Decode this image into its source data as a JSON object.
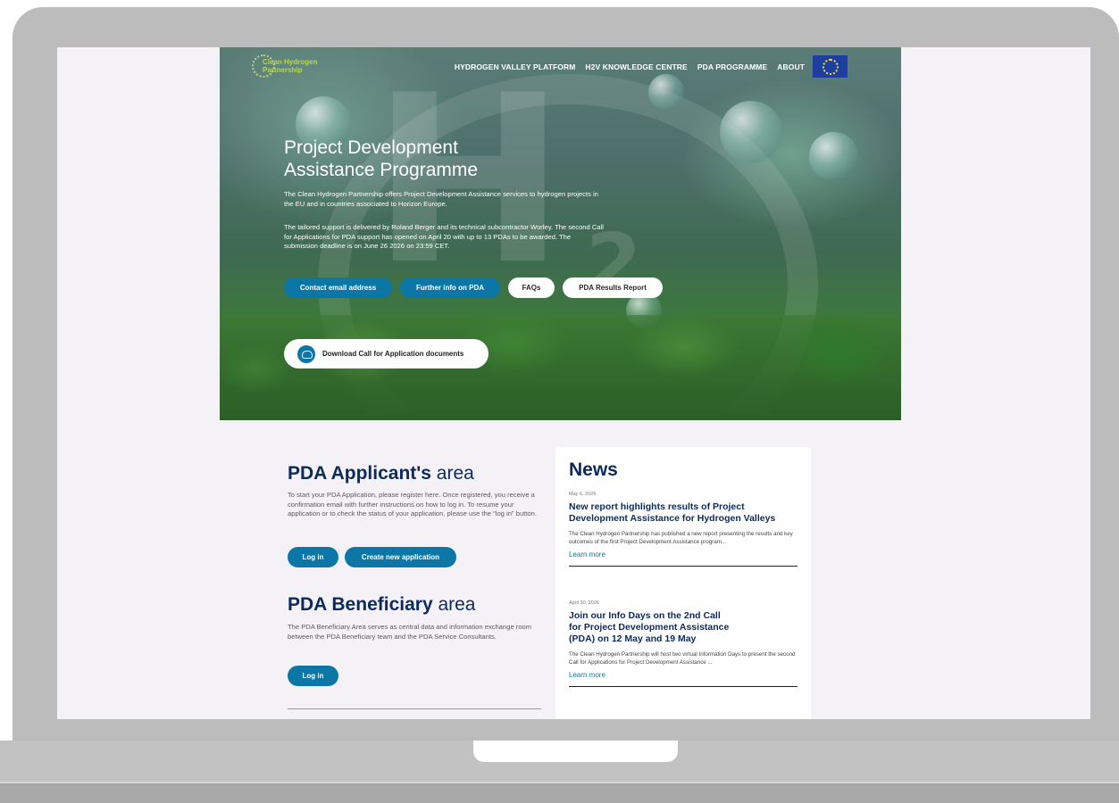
{
  "nav": {
    "logo_line1": "Clean Hydrogen",
    "logo_line2": "Partnership",
    "links": [
      "HYDROGEN VALLEY PLATFORM",
      "H2V KNOWLEDGE CENTRE",
      "PDA PROGRAMME",
      "ABOUT"
    ]
  },
  "hero": {
    "title_line1": "Project Development",
    "title_line2": "Assistance Programme",
    "paragraph1": "The Clean Hydrogen Partnership offers Project Development Assistance services to hydrogen projects in the EU and in countries associated to Horizon Europe.",
    "paragraph2": "The tailored support is delivered by Roland Berger and its technical subcontractor Worley. The second Call for Applications for PDA support has opened on April 20 with up to 13 PDAs to be awarded. The submission deadline is on June 26 2026 on 23:59 CET.",
    "buttons": [
      "Contact email address",
      "Further info on PDA",
      "FAQs",
      "PDA Results Report"
    ],
    "download_label": "Download Call for Application documents"
  },
  "applicant": {
    "title_bold": "PDA Applicant's",
    "title_light": " area",
    "text": "To start your PDA Application, please register here. Once registered, you receive a confirmation email with further instructions on how to log in. To resume your application or to check the status of your application, please use the \"log in\" button.",
    "login_label": "Log in",
    "create_label": "Create new application"
  },
  "beneficiary": {
    "title_bold": "PDA Beneficiary",
    "title_light": " area",
    "text": "The PDA Beneficiary Area serves as central data and information exchange room between the PDA Beneficiary team and the PDA Service Consultants.",
    "login_label": "Log in"
  },
  "news": {
    "title": "News",
    "items": [
      {
        "date": "May 6, 2026",
        "headline_l1": "New report highlights results of Project",
        "headline_l2": "Development Assistance for Hydrogen Valleys",
        "headline_l3": "",
        "body": "The Clean Hydrogen Partnership has published a new report presenting the results and key outcomes of the first Project Development Assistance program...",
        "link": "Learn more"
      },
      {
        "date": "April 30, 2026",
        "headline_l1": "Join our Info Days on the 2nd Call",
        "headline_l2": "for Project Development Assistance",
        "headline_l3": "(PDA) on 12 May and 19 May",
        "body": "The Clean Hydrogen Partnership will host two virtual Information Days to present the second Call for Applications for Project Development Assistance ...",
        "link": "Learn more"
      }
    ]
  },
  "colors": {
    "accent": "#0c77a6",
    "heading": "#0d2a5c",
    "frame": "#bcbcbc"
  }
}
